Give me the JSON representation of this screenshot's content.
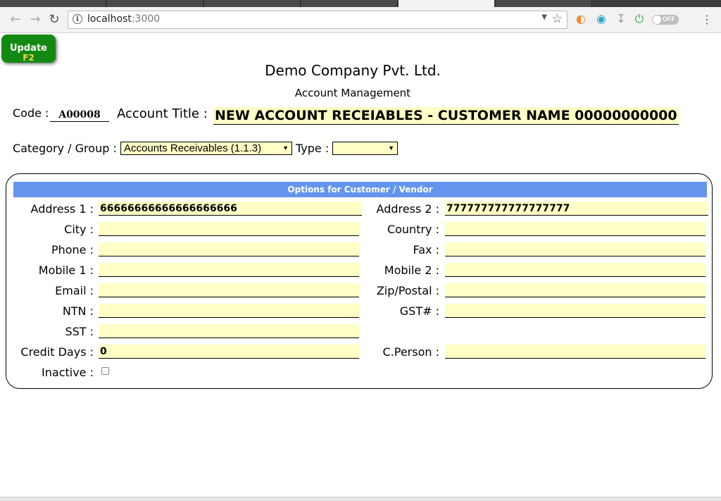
{
  "browser": {
    "url_host": "localhost",
    "url_port": ":3000",
    "toggle_label": "OFF"
  },
  "toolbar": {
    "update_label": "Update",
    "update_hotkey": "F2"
  },
  "header": {
    "company": "Demo Company Pvt. Ltd.",
    "subtitle": "Account Management"
  },
  "account": {
    "code_label": "Code :",
    "code_value": "A00008",
    "title_label": "Account Title :",
    "title_value": "NEW ACCOUNT RECEIABLES - CUSTOMER NAME 00000000000",
    "category_label": "Category / Group :",
    "category_value": "Accounts Receivables (1.1.3)",
    "type_label": "Type :",
    "type_value": ""
  },
  "panel": {
    "title": "Options for Customer / Vendor",
    "left_fields": [
      {
        "label": "Address 1 :",
        "value": "66666666666666666666"
      },
      {
        "label": "City :",
        "value": ""
      },
      {
        "label": "Phone :",
        "value": ""
      },
      {
        "label": "Mobile 1 :",
        "value": ""
      },
      {
        "label": "Email :",
        "value": ""
      },
      {
        "label": "NTN :",
        "value": ""
      },
      {
        "label": "SST :",
        "value": ""
      },
      {
        "label": "Credit Days :",
        "value": "0"
      },
      {
        "label": "Inactive :",
        "value": ""
      }
    ],
    "right_fields": [
      {
        "label": "Address 2 :",
        "value": "777777777777777777"
      },
      {
        "label": "Country :",
        "value": ""
      },
      {
        "label": "Fax :",
        "value": ""
      },
      {
        "label": "Mobile 2 :",
        "value": ""
      },
      {
        "label": "Zip/Postal :",
        "value": ""
      },
      {
        "label": "GST# :",
        "value": ""
      },
      {
        "label": "C.Person :",
        "value": ""
      }
    ]
  }
}
